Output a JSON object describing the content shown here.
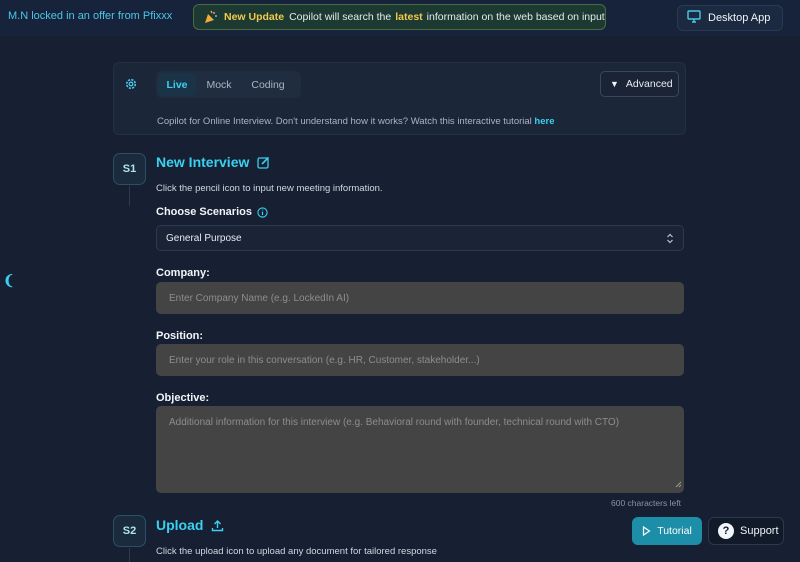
{
  "topbar": {
    "ticker_text": "M.N locked in an offer from Pfixxx",
    "update": {
      "badge": "New Update",
      "text_before": "Copilot will search the",
      "highlight": "latest",
      "text_after": "information on the web based on input"
    },
    "desktop_app_label": "Desktop App"
  },
  "mode_card": {
    "tabs": [
      {
        "label": "Live",
        "active": true
      },
      {
        "label": "Mock",
        "active": false
      },
      {
        "label": "Coding",
        "active": false
      }
    ],
    "advanced_label": "Advanced",
    "description": "Copilot for Online Interview. Don't understand how it works? Watch this interactive tutorial",
    "tutorial_link": "here"
  },
  "step1": {
    "badge": "S1",
    "title": "New Interview",
    "helper": "Click the pencil icon to input new meeting information.",
    "scenarios_label": "Choose Scenarios",
    "scenario_value": "General Purpose",
    "company_label": "Company:",
    "company_placeholder": "Enter Company Name (e.g. LockedIn AI)",
    "position_label": "Position:",
    "position_placeholder": "Enter your role in this conversation (e.g. HR, Customer, stakeholder...)",
    "objective_label": "Objective:",
    "objective_placeholder": "Additional information for this interview (e.g. Behavioral round with founder, technical round with CTO)",
    "chars_left": "600 characters left"
  },
  "step2": {
    "badge": "S2",
    "title": "Upload",
    "helper": "Click the upload icon to upload any document for tailored response"
  },
  "floating": {
    "tutorial_label": "Tutorial",
    "support_label": "Support"
  },
  "side_toggle_glyph": "❨",
  "colors": {
    "background": "#162032",
    "accent": "#3ad0f0",
    "highlight": "#f2c94c",
    "input_bg": "#444444",
    "tutorial_button": "#1d8ea7"
  },
  "icons": [
    "party-popper-icon",
    "monitor-icon",
    "gear-icon",
    "pencil-edit-icon",
    "info-icon",
    "chevron-updown-icon",
    "upload-icon",
    "play-icon",
    "question-icon",
    "resize-handle-icon"
  ]
}
